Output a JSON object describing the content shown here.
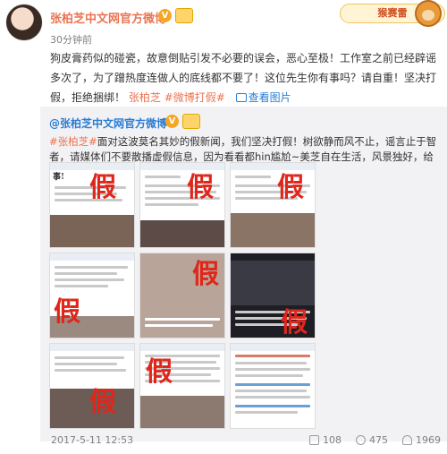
{
  "post": {
    "author": "张柏芝中文网官方微博",
    "verified_badge": "V",
    "time_ago": "30分钟前",
    "text_1": "狗皮膏药似的碰瓷，故意倒贴引发不必要的误会，恶心至极！工作室之前已经辟谣多次了，为了蹭热度连做人的底线都不要了！这位先生你有事吗？请自重！坚决打假，拒绝捆绑！",
    "tag_1": "张柏芝",
    "tag_2": "#微博打假#",
    "pic_link": "查看图片"
  },
  "sticker": {
    "label": "猴赛雷"
  },
  "repost": {
    "author": "@张柏芝中文网官方微博",
    "verified_badge": "V",
    "tag": "#张柏芝#",
    "text": "面对这波莫名其妙的假新闻，我们坚决打假！树欲静而风不止，谣言止于智者，请媒体们不要散播虚假信息，因为看看都hin尴尬~美芝自在生活，风景独好，给大家比心"
  },
  "tiles": [
    {
      "mark": "假",
      "caption": "事!"
    },
    {
      "mark": "假",
      "caption": ""
    },
    {
      "mark": "假",
      "caption": ""
    },
    {
      "mark": "假",
      "caption": ""
    },
    {
      "mark": "假",
      "caption": ""
    },
    {
      "mark": "假",
      "caption": ""
    },
    {
      "mark": "假",
      "caption": ""
    },
    {
      "mark": "假",
      "caption": ""
    },
    {
      "mark": "",
      "caption": ""
    }
  ],
  "footer": {
    "date": "2017-5-11 12:53",
    "shares": "108",
    "comments": "475",
    "likes": "1969"
  },
  "colors": {
    "accent": "#eb7350",
    "link": "#2b7cd3",
    "fake_mark": "#e0261b",
    "repost_bg": "#f2f2f5"
  }
}
